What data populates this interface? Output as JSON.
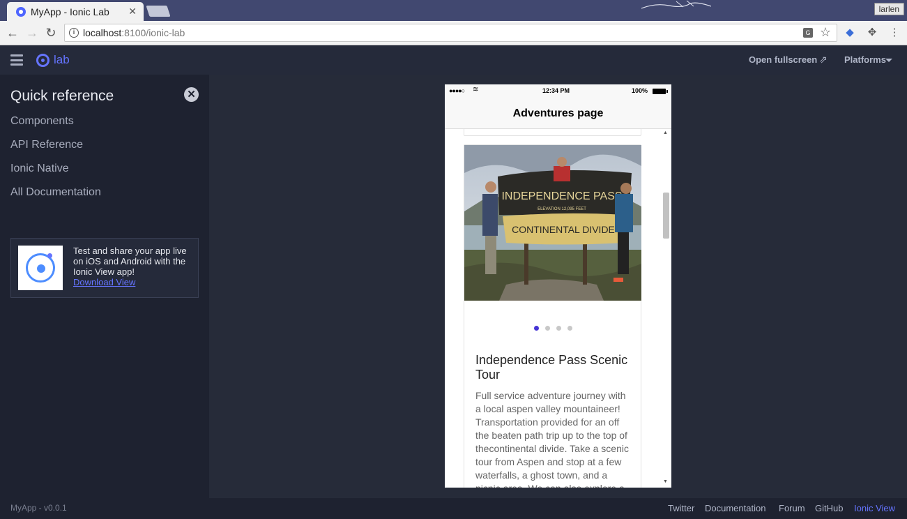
{
  "browser": {
    "tab_title": "MyApp - Ionic Lab",
    "tab_close": "✕",
    "user_badge": "larlen",
    "url_host": "localhost",
    "url_path": ":8100/ionic-lab",
    "translate_icon": "translate-icon",
    "star_icon": "bookmark-star-icon"
  },
  "lab": {
    "logo_text": "lab",
    "open_fullscreen": "Open fullscreen",
    "platforms": "Platforms"
  },
  "sidebar": {
    "title": "Quick reference",
    "close": "✕",
    "links": [
      {
        "label": "Components"
      },
      {
        "label": "API Reference"
      },
      {
        "label": "Ionic Native"
      },
      {
        "label": "All Documentation"
      }
    ],
    "promo": {
      "text": "Test and share your app live on iOS and Android with the Ionic View app!",
      "link": "Download View"
    }
  },
  "footer": {
    "version": "MyApp - v0.0.1",
    "links": [
      {
        "label": "Twitter"
      },
      {
        "label": "Documentation"
      },
      {
        "label": "Forum"
      },
      {
        "label": "GitHub"
      },
      {
        "label": "Ionic View"
      }
    ],
    "active_color": "#6574ff"
  },
  "phone": {
    "status": {
      "signal": "●●●●○",
      "wifi": "≋",
      "time": "12:34 PM",
      "battery": "100%"
    },
    "page_title": "Adventures page",
    "card": {
      "photo_sign_line1": "INDEPENDENCE PASS",
      "photo_sign_line2": "ELEVATION 12,095 FEET",
      "photo_sign_line3": "CONTINENTAL DIVIDE",
      "slide_count": 4,
      "active_slide": 1,
      "title": "Independence Pass Scenic Tour",
      "description": "Full service adventure journey with a local aspen valley mountaineer! Transportation provided for an off the beaten path trip up to the top of thecontinental divide. Take a scenic tour from Aspen and stop at a few waterfalls, a ghost town, and a picnic area. We can also explore a"
    }
  },
  "colors": {
    "accent": "#6574ff",
    "active_dot": "#4634d4"
  }
}
